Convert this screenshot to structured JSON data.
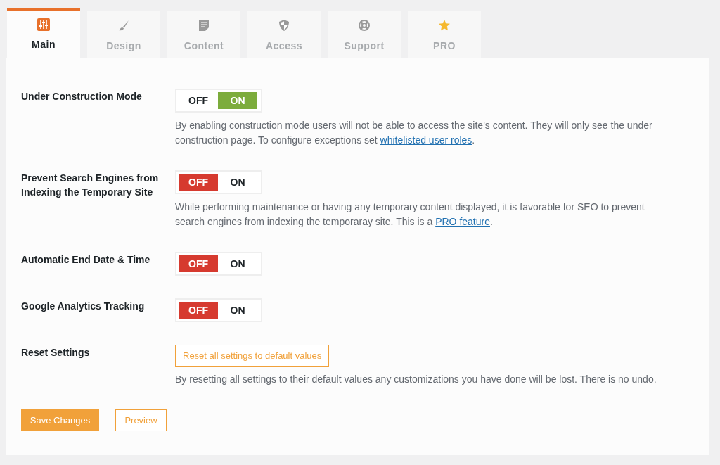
{
  "tabs": [
    {
      "label": "Main",
      "kind": "sliders",
      "selected": true
    },
    {
      "label": "Design",
      "kind": "brush",
      "selected": false
    },
    {
      "label": "Content",
      "kind": "document",
      "selected": false
    },
    {
      "label": "Access",
      "kind": "shield",
      "selected": false
    },
    {
      "label": "Support",
      "kind": "lifebuoy",
      "selected": false
    },
    {
      "label": "PRO",
      "kind": "star",
      "selected": false
    }
  ],
  "settings": [
    {
      "label": "Under Construction Mode",
      "kind": "toggle",
      "off_label": "OFF",
      "on_label": "ON",
      "on": true,
      "description": [
        {
          "kind": "text",
          "text": "By enabling construction mode users will not be able to access the site's content. They will only see the under construction page. To configure exceptions set "
        },
        {
          "kind": "link",
          "text": "whitelisted user roles"
        },
        {
          "kind": "text",
          "text": "."
        }
      ]
    },
    {
      "label": "Prevent Search Engines from Indexing the Temporary Site",
      "kind": "toggle",
      "off_label": "OFF",
      "on_label": "ON",
      "on": false,
      "description": [
        {
          "kind": "text",
          "text": "While performing maintenance or having any temporary content displayed, it is favorable for SEO to prevent search engines from indexing the temporaray site. This is a "
        },
        {
          "kind": "link",
          "text": "PRO feature"
        },
        {
          "kind": "text",
          "text": "."
        }
      ]
    },
    {
      "label": "Automatic End Date & Time",
      "kind": "toggle",
      "off_label": "OFF",
      "on_label": "ON",
      "on": false
    },
    {
      "label": "Google Analytics Tracking",
      "kind": "toggle",
      "off_label": "OFF",
      "on_label": "ON",
      "on": false
    },
    {
      "label": "Reset Settings",
      "kind": "button",
      "button": "Reset all settings to default values",
      "description": [
        {
          "kind": "text",
          "text": "By resetting all settings to their default values any customizations you have done will be lost. There is no undo."
        }
      ]
    }
  ],
  "actions": {
    "save": "Save Changes",
    "preview": "Preview"
  }
}
